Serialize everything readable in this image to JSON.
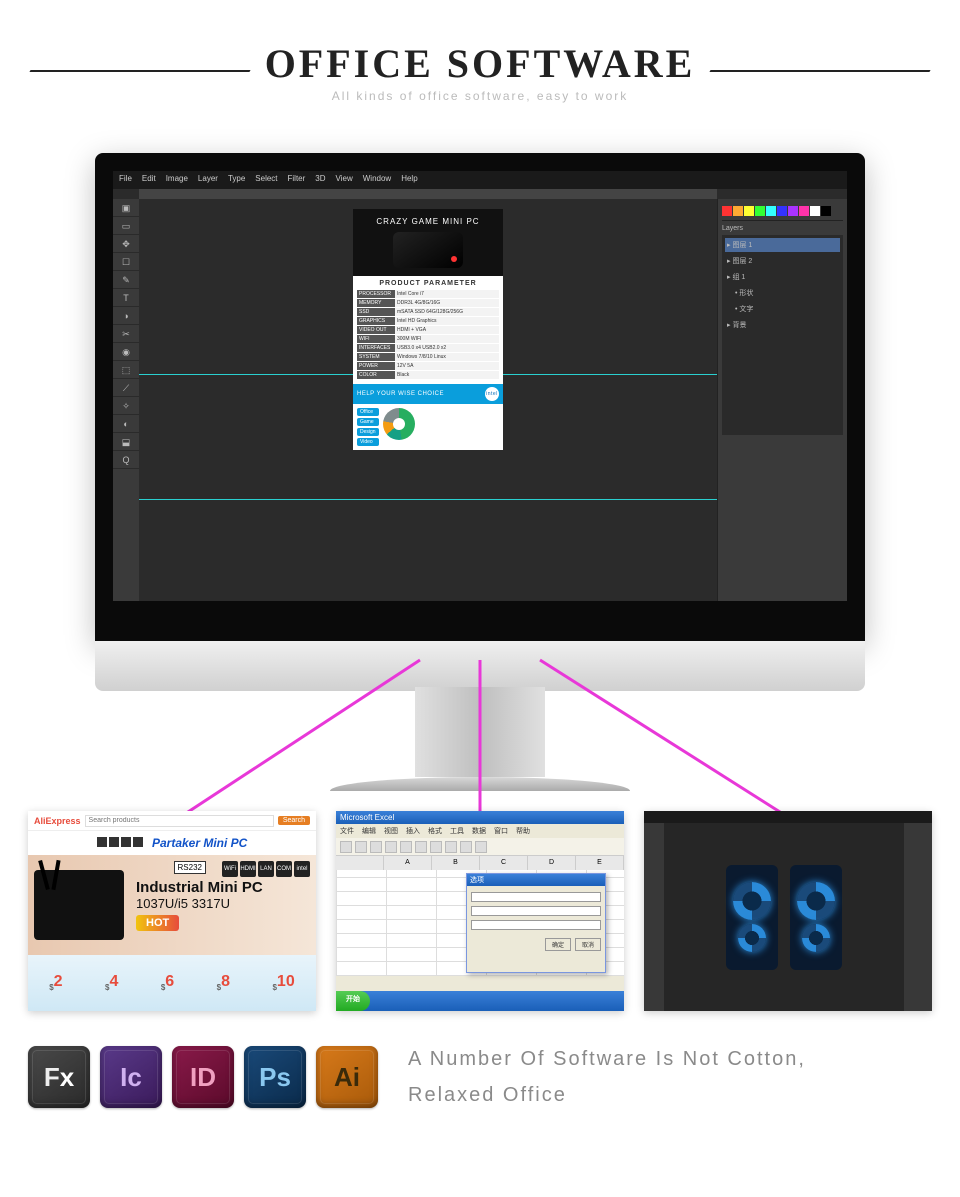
{
  "header": {
    "title": "OFFICE SOFTWARE",
    "subtitle": "All kinds of office software, easy to work"
  },
  "ps": {
    "menus": [
      "File",
      "Edit",
      "Image",
      "Layer",
      "Type",
      "Select",
      "Filter",
      "3D",
      "View",
      "Window",
      "Help"
    ],
    "artwork": {
      "dark_title": "CRAZY GAME MINI PC",
      "white_title": "PRODUCT PARAMETER",
      "specs": [
        {
          "k": "PROCESSOR",
          "v": "Intel Core i7"
        },
        {
          "k": "MEMORY",
          "v": "DDR3L 4G/8G/16G"
        },
        {
          "k": "SSD",
          "v": "mSATA SSD 64G/128G/256G"
        },
        {
          "k": "GRAPHICS",
          "v": "Intel HD Graphics"
        },
        {
          "k": "VIDEO OUT",
          "v": "HDMI + VGA"
        },
        {
          "k": "WIFI",
          "v": "300M WIFI"
        },
        {
          "k": "INTERFACES",
          "v": "USB3.0 x4 USB2.0 x2"
        },
        {
          "k": "SYSTEM",
          "v": "Windows 7/8/10 Linux"
        },
        {
          "k": "POWER",
          "v": "12V 5A"
        },
        {
          "k": "COLOR",
          "v": "Black"
        }
      ],
      "blue_title": "HELP YOUR WISE CHOICE",
      "intel": "intel",
      "chart_labels": [
        "Office",
        "Game",
        "Design",
        "Video"
      ]
    }
  },
  "thumbs": {
    "t1": {
      "logo": "AliExpress",
      "search_placeholder": "Search products",
      "search_btn": "Search",
      "partaker": "Partaker Mini PC",
      "hero_title": "Industrial Mini PC",
      "hero_cpu": "1037U/i5 3317U",
      "hot": "HOT",
      "rs232": "RS232",
      "badges": [
        "WiFi",
        "HDMI",
        "LAN",
        "COM",
        "intel"
      ],
      "deals": [
        "2",
        "4",
        "6",
        "8",
        "10"
      ]
    },
    "t2": {
      "title": "Microsoft Excel",
      "menus": [
        "文件",
        "编辑",
        "视图",
        "插入",
        "格式",
        "工具",
        "数据",
        "窗口",
        "帮助"
      ],
      "cols": [
        "",
        "A",
        "B",
        "C",
        "D",
        "E"
      ],
      "dialog_title": "选项",
      "dialog_ok": "确定",
      "dialog_cancel": "取消",
      "start": "开始"
    }
  },
  "icons": [
    {
      "key": "fx",
      "a": "F",
      "b": "x"
    },
    {
      "key": "ic",
      "a": "I",
      "b": "c"
    },
    {
      "key": "id",
      "a": "I",
      "b": "D"
    },
    {
      "key": "ps",
      "a": "P",
      "b": "s"
    },
    {
      "key": "ai",
      "a": "A",
      "b": "i"
    }
  ],
  "footer_text_1": "A Number Of Software Is Not Cotton,",
  "footer_text_2": "Relaxed Office"
}
